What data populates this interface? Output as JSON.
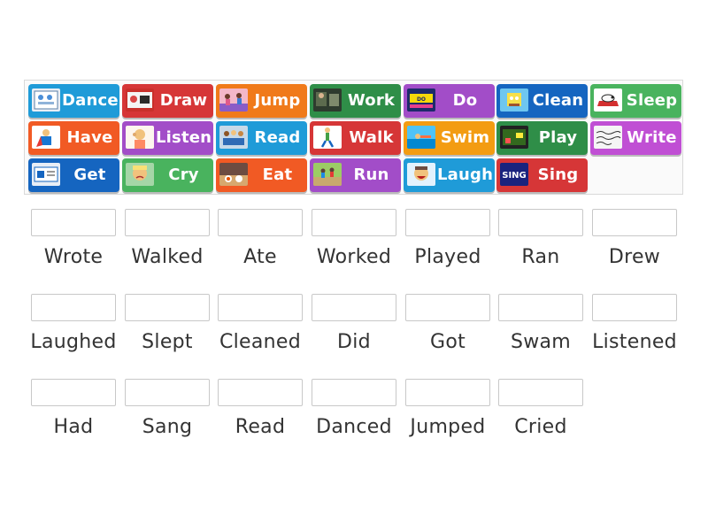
{
  "cards": [
    {
      "label": "Dance",
      "color": "#1f9bd8",
      "thumb": "classroom-poster"
    },
    {
      "label": "Draw",
      "color": "#d63637",
      "thumb": "drawing-kids"
    },
    {
      "label": "Jump",
      "color": "#f07a1a",
      "thumb": "jumping-dancers"
    },
    {
      "label": "Work",
      "color": "#2f8e48",
      "thumb": "office-workers"
    },
    {
      "label": "Do",
      "color": "#a24dc8",
      "thumb": "title-card"
    },
    {
      "label": "Clean",
      "color": "#1565c0",
      "thumb": "cartoon-clean"
    },
    {
      "label": "Sleep",
      "color": "#49b35e",
      "thumb": "snoopy"
    },
    {
      "label": "Have",
      "color": "#f15a24",
      "thumb": "superhero"
    },
    {
      "label": "Listen",
      "color": "#a24dc8",
      "thumb": "child-listening"
    },
    {
      "label": "Read",
      "color": "#1f9bd8",
      "thumb": "group-reading"
    },
    {
      "label": "Walk",
      "color": "#d63637",
      "thumb": "walking-figure"
    },
    {
      "label": "Swim",
      "color": "#f39c12",
      "thumb": "swimmer"
    },
    {
      "label": "Play",
      "color": "#2f8e48",
      "thumb": "video-game"
    },
    {
      "label": "Write",
      "color": "#c04fd4",
      "thumb": "handwriting"
    },
    {
      "label": "Get",
      "color": "#1565c0",
      "thumb": "shop-sign"
    },
    {
      "label": "Cry",
      "color": "#49b35e",
      "thumb": "crying-child"
    },
    {
      "label": "Eat",
      "color": "#f15a24",
      "thumb": "dinner-table"
    },
    {
      "label": "Run",
      "color": "#a24dc8",
      "thumb": "runners-park"
    },
    {
      "label": "Laugh",
      "color": "#1f9bd8",
      "thumb": "laughing-man"
    },
    {
      "label": "Sing",
      "color": "#d63637",
      "thumb": "sing-text"
    }
  ],
  "targets": [
    "Wrote",
    "Walked",
    "Ate",
    "Worked",
    "Played",
    "Ran",
    "Drew",
    "Laughed",
    "Slept",
    "Cleaned",
    "Did",
    "Got",
    "Swam",
    "Listened",
    "Had",
    "Sang",
    "Read",
    "Danced",
    "Jumped",
    "Cried"
  ]
}
